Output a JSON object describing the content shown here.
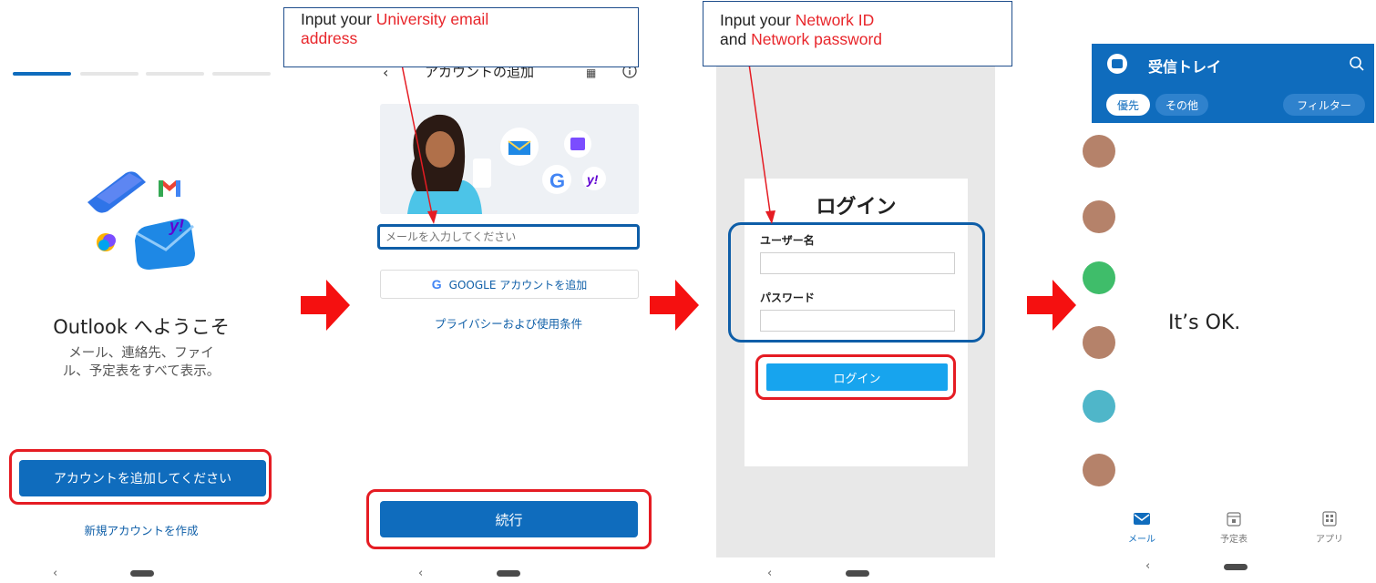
{
  "panel1": {
    "title": "Outlook へようこそ",
    "subtitle": "メール、連絡先、ファイ\nル、予定表をすべて表示。",
    "add_account_button": "アカウントを追加してください",
    "create_account_link": "新規アカウントを作成",
    "back_glyph": "‹"
  },
  "panel2": {
    "header_title": "アカウントの追加",
    "email_placeholder": "メールを入力してください",
    "google_button": "GOOGLE アカウントを追加",
    "privacy_link": "プライバシーおよび使用条件",
    "continue_button": "続行",
    "back_glyph": "‹"
  },
  "panel3": {
    "login_title": "ログイン",
    "username_label": "ユーザー名",
    "password_label": "パスワード",
    "login_button": "ログイン",
    "back_glyph": "‹"
  },
  "panel4": {
    "inbox_title": "受信トレイ",
    "tab_focused": "優先",
    "tab_other": "その他",
    "filter_button": "フィルター",
    "status_text": "It’s OK.",
    "nav_mail": "メール",
    "nav_calendar": "予定表",
    "nav_apps": "アプリ",
    "back_glyph": "‹"
  },
  "callouts": {
    "c1_prefix": "Input your ",
    "c1_highlight_line1": "University email",
    "c1_highlight_line2": "address",
    "c2_prefix": "Input your ",
    "c2_highlight1": "Network ID",
    "c2_and": "and ",
    "c2_highlight2": "Network password"
  },
  "colors": {
    "outlook_blue": "#0f6cbd",
    "login_blue": "#17a4ee",
    "highlight_red": "#e51c23",
    "arrow_red": "#f51010",
    "outline_blue": "#0e5ea8"
  },
  "icons": [
    "outlook-logo-icon",
    "gmail-icon",
    "yahoo-icon",
    "copilot-icon",
    "google-icon",
    "search-icon",
    "mail-icon",
    "calendar-icon",
    "apps-icon",
    "qr-icon",
    "info-icon"
  ]
}
